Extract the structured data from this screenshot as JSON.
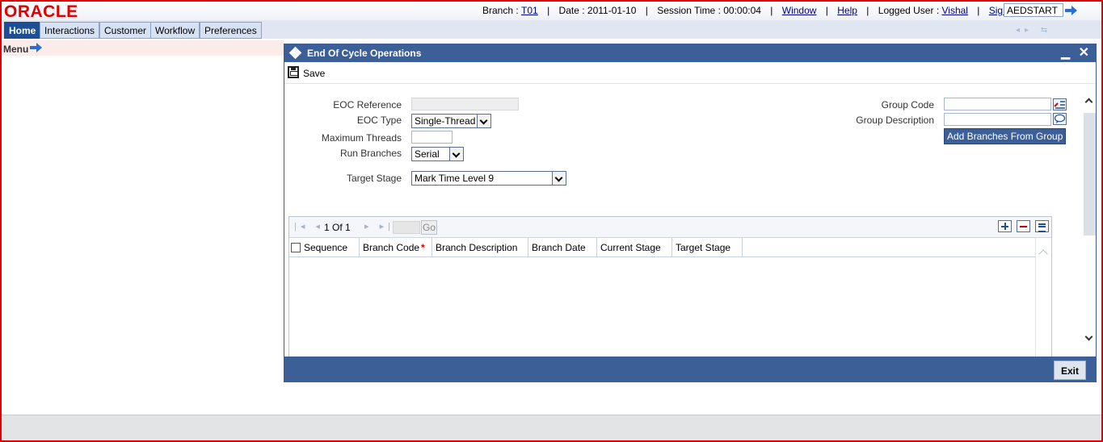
{
  "app": {
    "logo": "ORACLE"
  },
  "header": {
    "branch_label": "Branch : ",
    "branch_value": "T01",
    "date_label": "Date : ",
    "date_value": "2011-01-10",
    "session_label": "Session Time : ",
    "session_value": "00:00:04",
    "window_link": "Window",
    "help_link": "Help",
    "logged_user_label": "Logged User : ",
    "logged_user_value": "Vishal",
    "sign_off_link": "Sign Off",
    "function_input_value": "AEDSTART",
    "separator": "|"
  },
  "tabs": [
    {
      "label": "Home",
      "active": true
    },
    {
      "label": "Interactions",
      "active": false
    },
    {
      "label": "Customer",
      "active": false
    },
    {
      "label": "Workflow",
      "active": false
    },
    {
      "label": "Preferences",
      "active": false
    }
  ],
  "menu": {
    "label": "Menu"
  },
  "dialog": {
    "title": "End Of Cycle Operations",
    "min_glyph": "▁",
    "close_glyph": "✕",
    "toolbar": {
      "save_label": "Save"
    },
    "form": {
      "eoc_reference_label": "EOC Reference",
      "eoc_reference_value": "",
      "eoc_type_label": "EOC Type",
      "eoc_type_value": "Single-Thread",
      "maximum_threads_label": "Maximum Threads",
      "maximum_threads_value": "",
      "run_branches_label": "Run Branches",
      "run_branches_value": "Serial",
      "target_stage_label": "Target Stage",
      "target_stage_value": "Mark Time Level 9",
      "group_code_label": "Group Code",
      "group_code_value": "",
      "group_description_label": "Group Description",
      "group_description_value": "",
      "add_branches_button": "Add Branches From Group"
    },
    "grid": {
      "pager": {
        "page_text": "1 Of 1",
        "go_label": "Go"
      },
      "columns": [
        "Sequence",
        "Branch Code",
        "Branch Description",
        "Branch Date",
        "Current Stage",
        "Target Stage"
      ],
      "required_marker": "*",
      "rows": []
    },
    "footer": {
      "exit_label": "Exit"
    }
  },
  "colors": {
    "brand_red": "#e00000",
    "dialog_blue": "#3d5f98",
    "tab_active": "#1e4f96"
  }
}
